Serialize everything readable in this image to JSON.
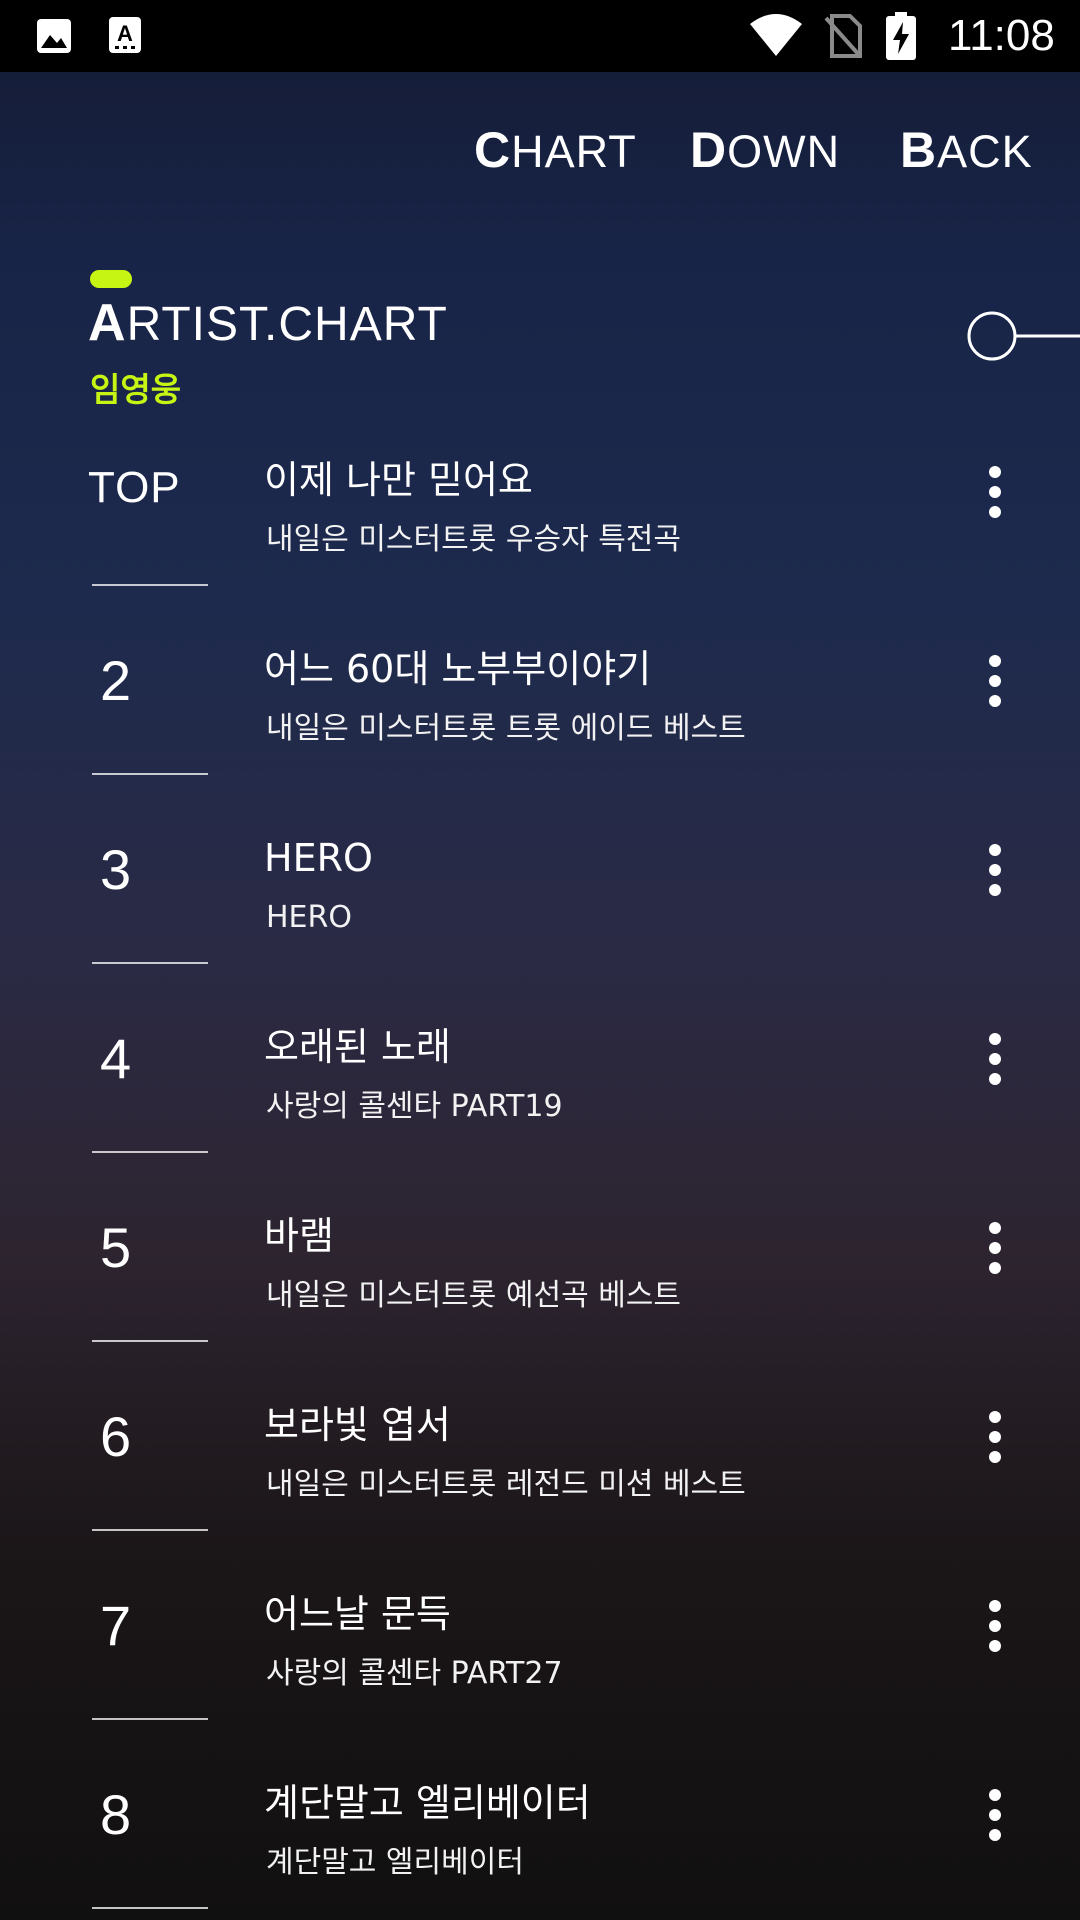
{
  "status_bar": {
    "time": "11:08",
    "icons": [
      "gallery-icon",
      "font-icon",
      "wifi-icon",
      "no-sim-icon",
      "battery-charging-icon"
    ]
  },
  "nav": {
    "chart": {
      "first": "C",
      "rest": "HART"
    },
    "down": {
      "first": "D",
      "rest": "OWN"
    },
    "back": {
      "first": "B",
      "rest": "ACK"
    }
  },
  "header": {
    "title_first": "A",
    "title_rest": "RTIST.CHART",
    "artist": "임영웅",
    "accent_color": "#c6f514"
  },
  "songs": [
    {
      "rank": "TOP",
      "title": "이제 나만 믿어요",
      "album": "내일은 미스터트롯 우승자 특전곡"
    },
    {
      "rank": "2",
      "title": "어느 60대 노부부이야기",
      "album": "내일은 미스터트롯 트롯 에이드 베스트"
    },
    {
      "rank": "3",
      "title": "HERO",
      "album": "HERO"
    },
    {
      "rank": "4",
      "title": "오래된 노래",
      "album": "사랑의 콜센타 PART19"
    },
    {
      "rank": "5",
      "title": "바램",
      "album": "내일은 미스터트롯 예선곡 베스트"
    },
    {
      "rank": "6",
      "title": "보라빛 엽서",
      "album": "내일은 미스터트롯 레전드 미션 베스트"
    },
    {
      "rank": "7",
      "title": "어느날 문득",
      "album": "사랑의 콜센타 PART27"
    },
    {
      "rank": "8",
      "title": "계단말고 엘리베이터",
      "album": "계단말고 엘리베이터"
    }
  ]
}
